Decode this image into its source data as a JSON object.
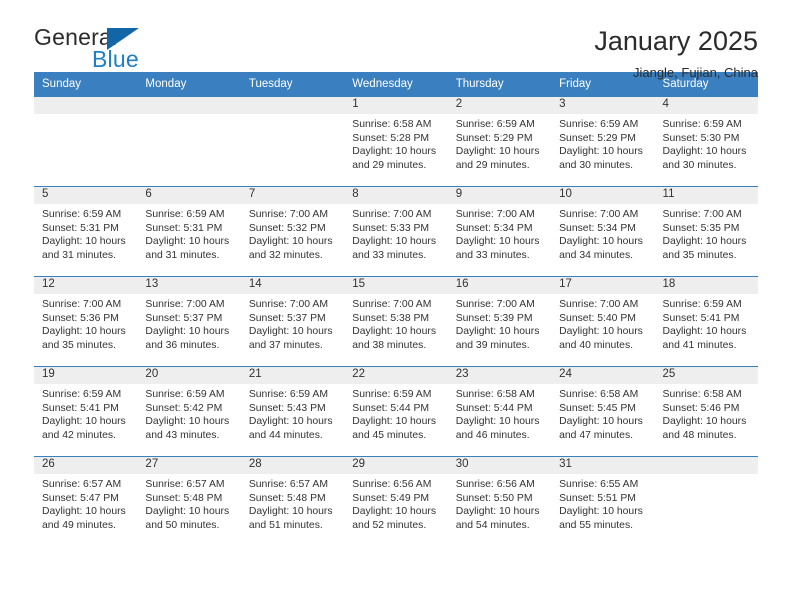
{
  "brand": {
    "name_top": "General",
    "name_bottom": "Blue",
    "triangle_color": "#1266a8",
    "blue_color": "#1f7fc4"
  },
  "header": {
    "title": "January 2025",
    "subtitle": "Jiangle, Fujian, China"
  },
  "theme": {
    "header_blue": "#3a7fbf",
    "daynum_band": "#eeeeee",
    "text": "#333333"
  },
  "weekday_headers": [
    "Sunday",
    "Monday",
    "Tuesday",
    "Wednesday",
    "Thursday",
    "Friday",
    "Saturday"
  ],
  "weeks": [
    [
      {
        "day": "",
        "sunrise": "",
        "sunset": "",
        "daylight": ""
      },
      {
        "day": "",
        "sunrise": "",
        "sunset": "",
        "daylight": ""
      },
      {
        "day": "",
        "sunrise": "",
        "sunset": "",
        "daylight": ""
      },
      {
        "day": "1",
        "sunrise": "Sunrise: 6:58 AM",
        "sunset": "Sunset: 5:28 PM",
        "daylight": "Daylight: 10 hours and 29 minutes."
      },
      {
        "day": "2",
        "sunrise": "Sunrise: 6:59 AM",
        "sunset": "Sunset: 5:29 PM",
        "daylight": "Daylight: 10 hours and 29 minutes."
      },
      {
        "day": "3",
        "sunrise": "Sunrise: 6:59 AM",
        "sunset": "Sunset: 5:29 PM",
        "daylight": "Daylight: 10 hours and 30 minutes."
      },
      {
        "day": "4",
        "sunrise": "Sunrise: 6:59 AM",
        "sunset": "Sunset: 5:30 PM",
        "daylight": "Daylight: 10 hours and 30 minutes."
      }
    ],
    [
      {
        "day": "5",
        "sunrise": "Sunrise: 6:59 AM",
        "sunset": "Sunset: 5:31 PM",
        "daylight": "Daylight: 10 hours and 31 minutes."
      },
      {
        "day": "6",
        "sunrise": "Sunrise: 6:59 AM",
        "sunset": "Sunset: 5:31 PM",
        "daylight": "Daylight: 10 hours and 31 minutes."
      },
      {
        "day": "7",
        "sunrise": "Sunrise: 7:00 AM",
        "sunset": "Sunset: 5:32 PM",
        "daylight": "Daylight: 10 hours and 32 minutes."
      },
      {
        "day": "8",
        "sunrise": "Sunrise: 7:00 AM",
        "sunset": "Sunset: 5:33 PM",
        "daylight": "Daylight: 10 hours and 33 minutes."
      },
      {
        "day": "9",
        "sunrise": "Sunrise: 7:00 AM",
        "sunset": "Sunset: 5:34 PM",
        "daylight": "Daylight: 10 hours and 33 minutes."
      },
      {
        "day": "10",
        "sunrise": "Sunrise: 7:00 AM",
        "sunset": "Sunset: 5:34 PM",
        "daylight": "Daylight: 10 hours and 34 minutes."
      },
      {
        "day": "11",
        "sunrise": "Sunrise: 7:00 AM",
        "sunset": "Sunset: 5:35 PM",
        "daylight": "Daylight: 10 hours and 35 minutes."
      }
    ],
    [
      {
        "day": "12",
        "sunrise": "Sunrise: 7:00 AM",
        "sunset": "Sunset: 5:36 PM",
        "daylight": "Daylight: 10 hours and 35 minutes."
      },
      {
        "day": "13",
        "sunrise": "Sunrise: 7:00 AM",
        "sunset": "Sunset: 5:37 PM",
        "daylight": "Daylight: 10 hours and 36 minutes."
      },
      {
        "day": "14",
        "sunrise": "Sunrise: 7:00 AM",
        "sunset": "Sunset: 5:37 PM",
        "daylight": "Daylight: 10 hours and 37 minutes."
      },
      {
        "day": "15",
        "sunrise": "Sunrise: 7:00 AM",
        "sunset": "Sunset: 5:38 PM",
        "daylight": "Daylight: 10 hours and 38 minutes."
      },
      {
        "day": "16",
        "sunrise": "Sunrise: 7:00 AM",
        "sunset": "Sunset: 5:39 PM",
        "daylight": "Daylight: 10 hours and 39 minutes."
      },
      {
        "day": "17",
        "sunrise": "Sunrise: 7:00 AM",
        "sunset": "Sunset: 5:40 PM",
        "daylight": "Daylight: 10 hours and 40 minutes."
      },
      {
        "day": "18",
        "sunrise": "Sunrise: 6:59 AM",
        "sunset": "Sunset: 5:41 PM",
        "daylight": "Daylight: 10 hours and 41 minutes."
      }
    ],
    [
      {
        "day": "19",
        "sunrise": "Sunrise: 6:59 AM",
        "sunset": "Sunset: 5:41 PM",
        "daylight": "Daylight: 10 hours and 42 minutes."
      },
      {
        "day": "20",
        "sunrise": "Sunrise: 6:59 AM",
        "sunset": "Sunset: 5:42 PM",
        "daylight": "Daylight: 10 hours and 43 minutes."
      },
      {
        "day": "21",
        "sunrise": "Sunrise: 6:59 AM",
        "sunset": "Sunset: 5:43 PM",
        "daylight": "Daylight: 10 hours and 44 minutes."
      },
      {
        "day": "22",
        "sunrise": "Sunrise: 6:59 AM",
        "sunset": "Sunset: 5:44 PM",
        "daylight": "Daylight: 10 hours and 45 minutes."
      },
      {
        "day": "23",
        "sunrise": "Sunrise: 6:58 AM",
        "sunset": "Sunset: 5:44 PM",
        "daylight": "Daylight: 10 hours and 46 minutes."
      },
      {
        "day": "24",
        "sunrise": "Sunrise: 6:58 AM",
        "sunset": "Sunset: 5:45 PM",
        "daylight": "Daylight: 10 hours and 47 minutes."
      },
      {
        "day": "25",
        "sunrise": "Sunrise: 6:58 AM",
        "sunset": "Sunset: 5:46 PM",
        "daylight": "Daylight: 10 hours and 48 minutes."
      }
    ],
    [
      {
        "day": "26",
        "sunrise": "Sunrise: 6:57 AM",
        "sunset": "Sunset: 5:47 PM",
        "daylight": "Daylight: 10 hours and 49 minutes."
      },
      {
        "day": "27",
        "sunrise": "Sunrise: 6:57 AM",
        "sunset": "Sunset: 5:48 PM",
        "daylight": "Daylight: 10 hours and 50 minutes."
      },
      {
        "day": "28",
        "sunrise": "Sunrise: 6:57 AM",
        "sunset": "Sunset: 5:48 PM",
        "daylight": "Daylight: 10 hours and 51 minutes."
      },
      {
        "day": "29",
        "sunrise": "Sunrise: 6:56 AM",
        "sunset": "Sunset: 5:49 PM",
        "daylight": "Daylight: 10 hours and 52 minutes."
      },
      {
        "day": "30",
        "sunrise": "Sunrise: 6:56 AM",
        "sunset": "Sunset: 5:50 PM",
        "daylight": "Daylight: 10 hours and 54 minutes."
      },
      {
        "day": "31",
        "sunrise": "Sunrise: 6:55 AM",
        "sunset": "Sunset: 5:51 PM",
        "daylight": "Daylight: 10 hours and 55 minutes."
      }
    ]
  ]
}
